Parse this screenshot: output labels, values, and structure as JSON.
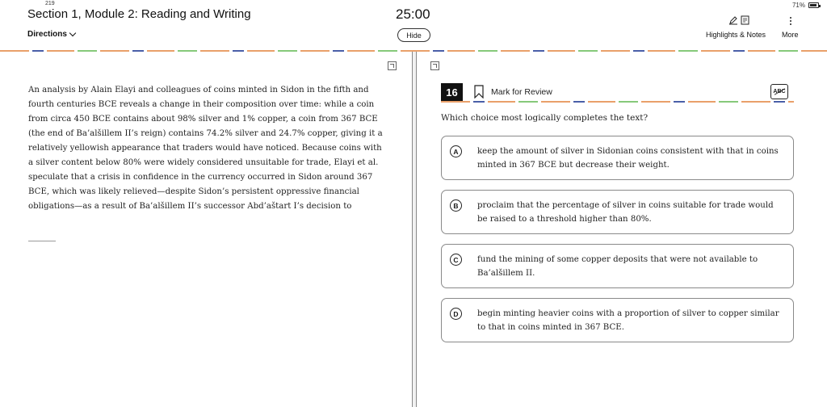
{
  "status": {
    "page_num": "219",
    "battery": "71%",
    "battery_level": 0.71
  },
  "header": {
    "section_title": "Section 1, Module 2: Reading and Writing",
    "timer": "25:00",
    "directions_label": "Directions",
    "hide_label": "Hide",
    "highlights_label": "Highlights & Notes",
    "more_label": "More"
  },
  "passage": {
    "text": "An analysis by Alain Elayi and colleagues of coins minted in Sidon in the fifth and fourth centuries BCE reveals a change in their composition over time: while a coin from circa 450 BCE contains about 98% silver and 1% copper, a coin from 367 BCE (the end of Ba’alšillem II’s reign) contains 74.2% silver and 24.7% copper, giving it a relatively yellowish appearance that traders would have noticed. Because coins with a silver content below 80% were widely considered unsuitable for trade, Elayi et al. speculate that a crisis in confidence in the currency occurred in Sidon around 367 BCE, which was likely relieved—despite Sidon’s persistent oppressive financial obligations—as a result of Ba’alšillem II’s successor Abd’aštart I’s decision to"
  },
  "question": {
    "number": "16",
    "mark_label": "Mark for Review",
    "abc_label": "ABC",
    "prompt": "Which choice most logically completes the text?",
    "choices": [
      {
        "letter": "A",
        "text": "keep the amount of silver in Sidonian coins consistent with that in coins minted in 367 BCE but decrease their weight."
      },
      {
        "letter": "B",
        "text": "proclaim that the percentage of silver in coins suitable for trade would be raised to a threshold higher than 80%."
      },
      {
        "letter": "C",
        "text": "fund the mining of some copper deposits that were not available to Ba’alšillem II."
      },
      {
        "letter": "D",
        "text": "begin minting heavier coins with a proportion of silver to copper similar to that in coins minted in 367 BCE."
      }
    ]
  },
  "colors": {
    "accent_orange": "#e9a06a",
    "accent_blue": "#4a5fa8",
    "accent_green": "#86c97a"
  }
}
